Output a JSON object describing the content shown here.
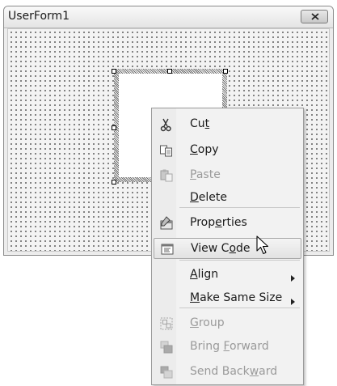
{
  "window": {
    "title": "UserForm1",
    "close_icon": "close-x-icon"
  },
  "context_menu": {
    "items": [
      {
        "pre": "Cu",
        "acc": "t",
        "post": "",
        "icon": "scissors-icon",
        "enabled": true
      },
      {
        "pre": "",
        "acc": "C",
        "post": "opy",
        "icon": "copy-icon",
        "enabled": true
      },
      {
        "pre": "",
        "acc": "P",
        "post": "aste",
        "icon": "paste-icon",
        "enabled": false
      },
      {
        "pre": "",
        "acc": "D",
        "post": "elete",
        "icon": "",
        "enabled": true
      },
      {
        "pre": "Prop",
        "acc": "e",
        "post": "rties",
        "icon": "properties-icon",
        "enabled": true
      },
      {
        "pre": "View C",
        "acc": "o",
        "post": "de",
        "icon": "view-code-icon",
        "enabled": true,
        "highlighted": true
      },
      {
        "pre": "",
        "acc": "A",
        "post": "lign",
        "icon": "",
        "enabled": true,
        "submenu": true
      },
      {
        "pre": "",
        "acc": "M",
        "post": "ake Same Size",
        "icon": "",
        "enabled": true,
        "submenu": true
      },
      {
        "pre": "",
        "acc": "G",
        "post": "roup",
        "icon": "group-icon",
        "enabled": false
      },
      {
        "pre": "Bring ",
        "acc": "F",
        "post": "orward",
        "icon": "bring-forward-icon",
        "enabled": false
      },
      {
        "pre": "Send Back",
        "acc": "w",
        "post": "ard",
        "icon": "send-backward-icon",
        "enabled": false
      }
    ]
  },
  "colors": {
    "highlight_border": "#a7a7a7",
    "disabled_text": "#9a9a9a"
  }
}
